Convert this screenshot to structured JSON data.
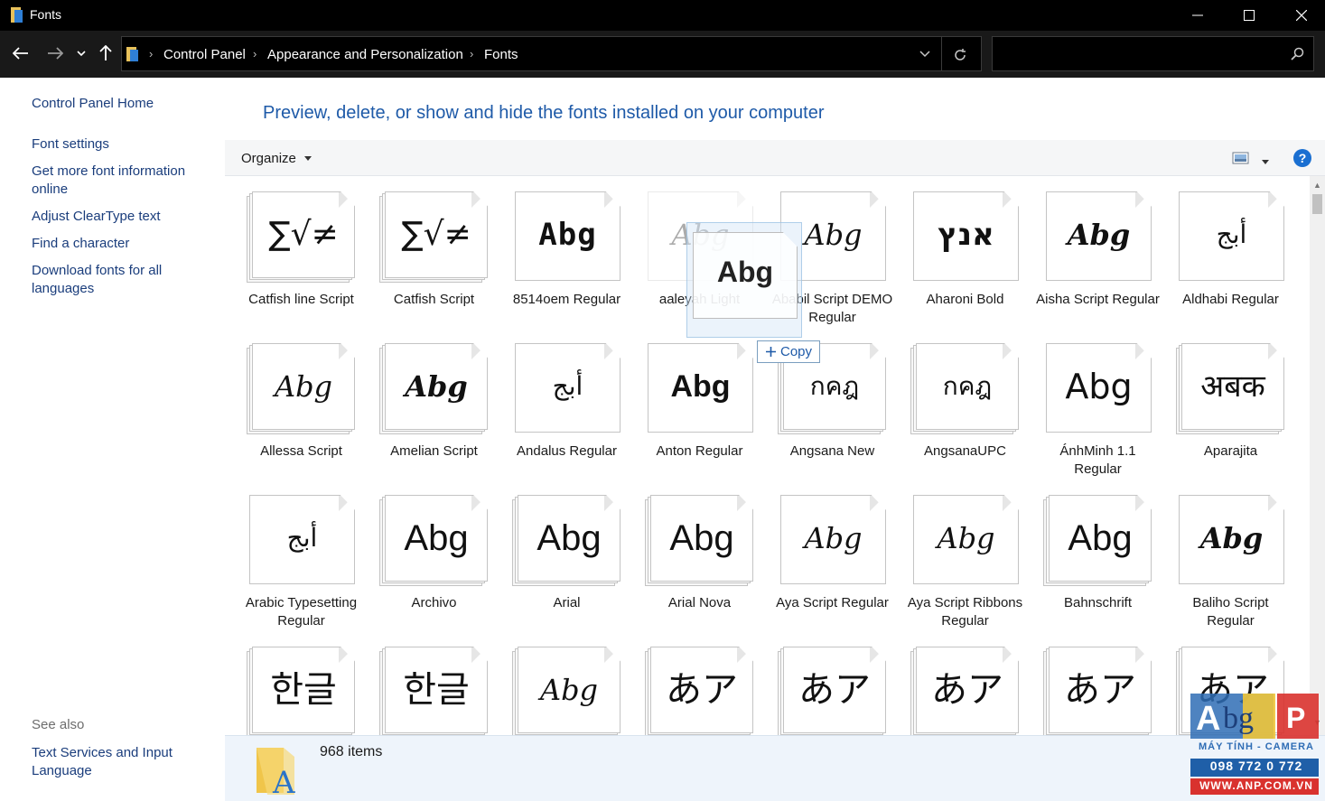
{
  "window": {
    "title": "Fonts"
  },
  "breadcrumb": [
    "Control Panel",
    "Appearance and Personalization",
    "Fonts"
  ],
  "search": {
    "placeholder": ""
  },
  "left_pane": {
    "links": [
      "Control Panel Home",
      "Font settings",
      "Get more font information online",
      "Adjust ClearType text",
      "Find a character",
      "Download fonts for all languages"
    ],
    "see_also_label": "See also",
    "see_also_links": [
      "Text Services and Input Language"
    ]
  },
  "main": {
    "heading": "Preview, delete, or show and hide the fonts installed on your computer",
    "toolbar": {
      "organize_label": "Organize",
      "help_label": "?"
    }
  },
  "fonts": [
    {
      "name": "Catfish line Script",
      "sample": "∑√≠",
      "style": "math",
      "stacked": true
    },
    {
      "name": "Catfish Script",
      "sample": "∑√≠",
      "style": "math",
      "stacked": true
    },
    {
      "name": "8514oem Regular",
      "sample": "Abg",
      "style": "pixel",
      "stacked": false
    },
    {
      "name": "aaleyah Light",
      "sample": "Abg",
      "style": "script",
      "stacked": false,
      "faded": true
    },
    {
      "name": "Ababil Script DEMO Regular",
      "sample": "Abg",
      "style": "script",
      "stacked": false
    },
    {
      "name": "Aharoni Bold",
      "sample": "אנץ",
      "style": "hebrew",
      "stacked": false
    },
    {
      "name": "Aisha Script Regular",
      "sample": "Abg",
      "style": "script-bold",
      "stacked": false
    },
    {
      "name": "Aldhabi Regular",
      "sample": "أبج",
      "style": "arabic",
      "stacked": false
    },
    {
      "name": "Allessa Script",
      "sample": "Abg",
      "style": "script",
      "stacked": true
    },
    {
      "name": "Amelian Script",
      "sample": "Abg",
      "style": "script-bold",
      "stacked": true
    },
    {
      "name": "Andalus Regular",
      "sample": "أبج",
      "style": "arabic",
      "stacked": false
    },
    {
      "name": "Anton Regular",
      "sample": "Abg",
      "style": "bold",
      "stacked": false
    },
    {
      "name": "Angsana New",
      "sample": "กคฎ",
      "style": "thai",
      "stacked": true
    },
    {
      "name": "AngsanaUPC",
      "sample": "กคฎ",
      "style": "thai",
      "stacked": true
    },
    {
      "name": "ÁnhMinh 1.1 Regular",
      "sample": "Abg",
      "style": "sans-light",
      "stacked": false
    },
    {
      "name": "Aparajita",
      "sample": "अबक",
      "style": "deva",
      "stacked": true
    },
    {
      "name": "Arabic Typesetting Regular",
      "sample": "أبج",
      "style": "arabic",
      "stacked": false
    },
    {
      "name": "Archivo",
      "sample": "Abg",
      "style": "sans",
      "stacked": true
    },
    {
      "name": "Arial",
      "sample": "Abg",
      "style": "sans",
      "stacked": true
    },
    {
      "name": "Arial Nova",
      "sample": "Abg",
      "style": "sans",
      "stacked": true
    },
    {
      "name": "Aya Script Regular",
      "sample": "Abg",
      "style": "script",
      "stacked": false
    },
    {
      "name": "Aya Script Ribbons Regular",
      "sample": "Abg",
      "style": "script",
      "stacked": false
    },
    {
      "name": "Bahnschrift",
      "sample": "Abg",
      "style": "sans",
      "stacked": true
    },
    {
      "name": "Baliho Script Regular",
      "sample": "Abg",
      "style": "script-bold",
      "stacked": false
    },
    {
      "name": "",
      "sample": "한글",
      "style": "cjk",
      "stacked": true
    },
    {
      "name": "",
      "sample": "한글",
      "style": "cjk",
      "stacked": true
    },
    {
      "name": "",
      "sample": "Abg",
      "style": "script",
      "stacked": true
    },
    {
      "name": "",
      "sample": "あア",
      "style": "cjk",
      "stacked": true
    },
    {
      "name": "",
      "sample": "あア",
      "style": "cjk",
      "stacked": true
    },
    {
      "name": "",
      "sample": "あア",
      "style": "cjk",
      "stacked": true
    },
    {
      "name": "",
      "sample": "あア",
      "style": "cjk",
      "stacked": true
    },
    {
      "name": "",
      "sample": "あア",
      "style": "cjk",
      "stacked": true
    }
  ],
  "drag": {
    "sample": "Abg",
    "copy_label": "Copy"
  },
  "status": {
    "item_count": "968 items"
  },
  "watermark": {
    "logo_text": "AbgP",
    "line1": "MÁY TÍNH - CAMERA",
    "line2": "098 772 0 772",
    "line3": "WWW.ANP.COM.VN"
  },
  "colors": {
    "link": "#1a3d7c",
    "heading": "#1e5aa8",
    "titlebar": "#000000",
    "accent": "#1a6fd1"
  }
}
